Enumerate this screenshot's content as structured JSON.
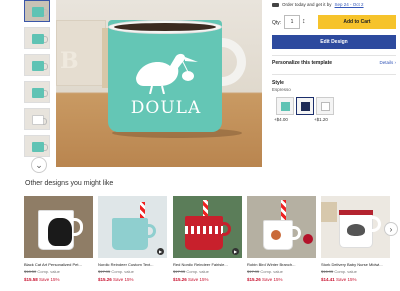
{
  "product": {
    "mug_text": "DOULA",
    "block_letter": "B"
  },
  "purchase": {
    "order_text": "Order today and get it by",
    "delivery_dates": "Sep 24 - Oct 2",
    "qty_label": "Qty:",
    "qty_value": "1",
    "add_to_cart_label": "Add to Cart",
    "edit_design_label": "Edit Design",
    "personalize_label": "Personalize this template",
    "details_label": "Details",
    "style_label": "Style",
    "style_value": "Espresso",
    "style_options": [
      {
        "price": "",
        "color": "teal"
      },
      {
        "price": "+$4.00",
        "color": "dark"
      },
      {
        "price": "+$1.20",
        "color": "white"
      }
    ]
  },
  "recommendations": {
    "title": "Other designs you might like",
    "items": [
      {
        "name": "Black Cat Art Personalized Pet...",
        "old_price": "$18.50",
        "comp": "Comp. value",
        "price": "$15.58",
        "save": "Save 15%"
      },
      {
        "name": "Nordic Reindeer Custom Text...",
        "old_price": "$17.95",
        "comp": "Comp. value",
        "price": "$15.26",
        "save": "Save 15%"
      },
      {
        "name": "Red Nordic Reindeer Fairisle...",
        "old_price": "$17.95",
        "comp": "Comp. value",
        "price": "$15.26",
        "save": "Save 15%"
      },
      {
        "name": "Robin Bird Winter Branch...",
        "old_price": "$17.95",
        "comp": "Comp. value",
        "price": "$15.26",
        "save": "Save 15%"
      },
      {
        "name": "Stork Delivery Baby Nurse Midwi...",
        "old_price": "$16.95",
        "comp": "Comp. value",
        "price": "$14.41",
        "save": "Save 15%"
      }
    ]
  },
  "colors": {
    "accent_blue": "#2d4a9e",
    "cart_yellow": "#f6c32b",
    "sale_red": "#c8102e",
    "mug_teal": "#64c6b5"
  }
}
